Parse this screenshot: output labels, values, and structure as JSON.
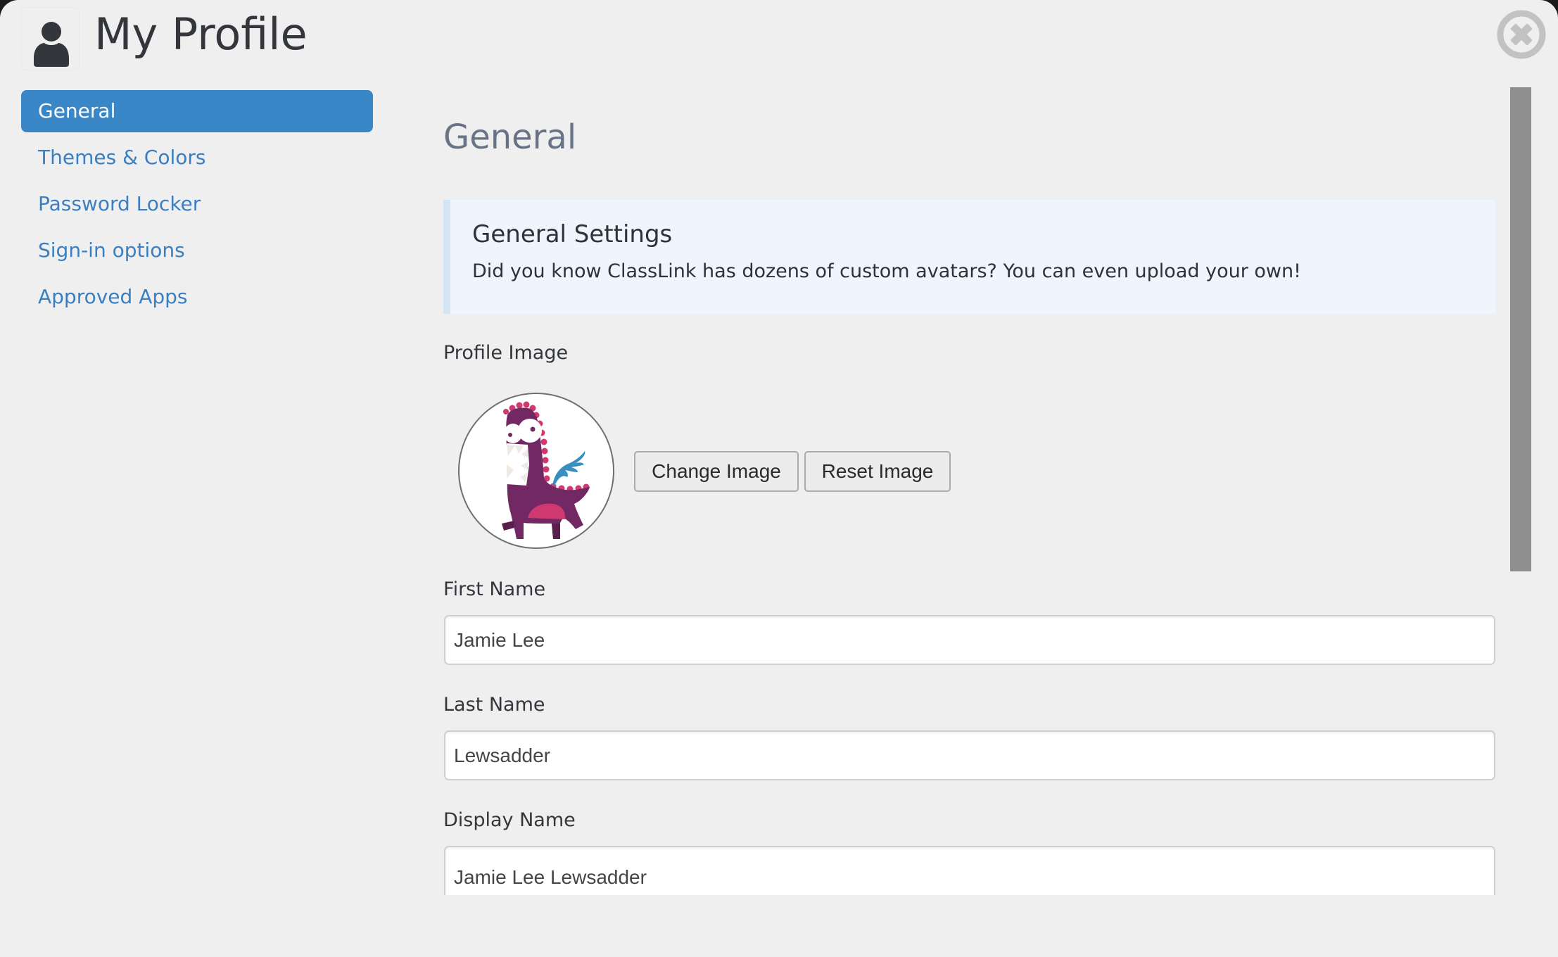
{
  "header": {
    "title": "My Profile",
    "icon": "user-icon",
    "close_icon": "close-circle-icon"
  },
  "sidebar": {
    "items": [
      {
        "label": "General",
        "active": true
      },
      {
        "label": "Themes & Colors",
        "active": false
      },
      {
        "label": "Password Locker",
        "active": false
      },
      {
        "label": "Sign-in options",
        "active": false
      },
      {
        "label": "Approved Apps",
        "active": false
      }
    ]
  },
  "main": {
    "section_title": "General",
    "info": {
      "title": "General Settings",
      "text": "Did you know ClassLink has dozens of custom avatars? You can even upload your own!"
    },
    "profile_image": {
      "label": "Profile Image",
      "avatar": "purple-dinosaur-avatar",
      "change_label": "Change Image",
      "reset_label": "Reset Image"
    },
    "fields": {
      "first_name": {
        "label": "First Name",
        "value": "Jamie Lee"
      },
      "last_name": {
        "label": "Last Name",
        "value": "Lewsadder"
      },
      "display_name": {
        "label": "Display Name",
        "value": "Jamie Lee Lewsadder"
      }
    }
  },
  "colors": {
    "accent": "#3987c6",
    "link": "#3a7fc1",
    "background": "#efefef",
    "info_bg": "#eff5fc",
    "info_border": "#d5e5f3",
    "scrollbar": "#8f8f8f"
  }
}
